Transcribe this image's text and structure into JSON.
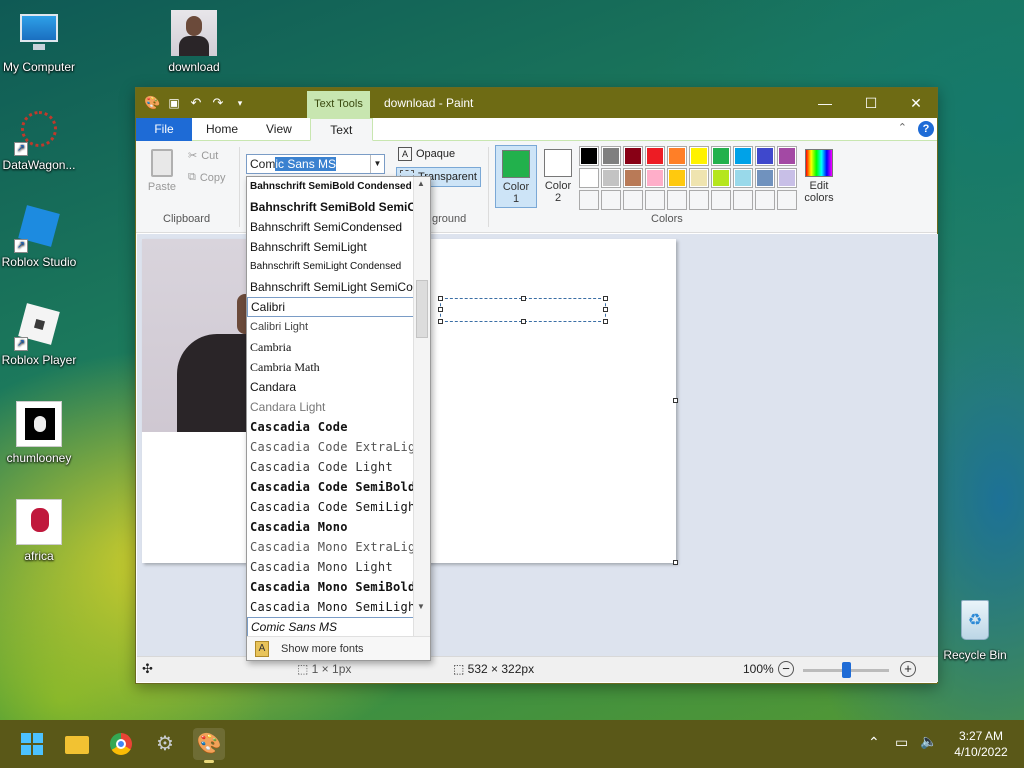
{
  "desktop": {
    "icons": [
      {
        "label": "My Computer"
      },
      {
        "label": "download"
      },
      {
        "label": "DataWagon..."
      },
      {
        "label": "Roblox Studio"
      },
      {
        "label": "Roblox Player"
      },
      {
        "label": "chumlooney"
      },
      {
        "label": "africa"
      },
      {
        "label": "Recycle Bin"
      }
    ]
  },
  "window": {
    "title": "download - Paint",
    "context_tab": "Text Tools",
    "tabs": [
      "File",
      "Home",
      "View",
      "Text"
    ]
  },
  "ribbon": {
    "clipboard": {
      "paste": "Paste",
      "cut": "Cut",
      "copy": "Copy",
      "group": "Clipboard"
    },
    "font_value": "Comic Sans MS",
    "font_value_parts": [
      "Com",
      "ic Sans MS"
    ],
    "background": {
      "opaque": "Opaque",
      "transparent": "Transparent",
      "group": "ground"
    },
    "colors": {
      "color1": "Color 1",
      "color1_line1": "Color",
      "color1_line2": "1",
      "color2": "Color 2",
      "color2_line1": "Color",
      "color2_line2": "2",
      "edit": "Edit colors",
      "edit_line1": "Edit",
      "edit_line2": "colors",
      "group": "Colors",
      "color1_hex": "#22b14c",
      "color2_hex": "#ffffff",
      "palette_row1": [
        "#000000",
        "#7f7f7f",
        "#880015",
        "#ed1c24",
        "#ff7f27",
        "#fff200",
        "#22b14c",
        "#00a2e8",
        "#3f48cc",
        "#a349a4"
      ],
      "palette_row2": [
        "#ffffff",
        "#c3c3c3",
        "#b97a57",
        "#ffaec9",
        "#ffc90e",
        "#efe4b0",
        "#b5e61d",
        "#99d9ea",
        "#7092be",
        "#c8bfe7"
      ]
    }
  },
  "font_list": {
    "items": [
      "Bahnschrift SemiBold Condensed",
      "Bahnschrift SemiBold SemiCondensed",
      "Bahnschrift SemiCondensed",
      "Bahnschrift SemiLight",
      "Bahnschrift SemiLight Condensed",
      "Bahnschrift SemiLight SemiCondensed",
      "Calibri",
      "Calibri Light",
      "Cambria",
      "Cambria Math",
      "Candara",
      "Candara Light",
      "Cascadia Code",
      "Cascadia Code ExtraLight",
      "Cascadia Code Light",
      "Cascadia Code SemiBold",
      "Cascadia Code SemiLight",
      "Cascadia Mono",
      "Cascadia Mono ExtraLight",
      "Cascadia Mono Light",
      "Cascadia Mono SemiBold",
      "Cascadia Mono SemiLight",
      "Comic Sans MS"
    ],
    "show_more": "Show more fonts"
  },
  "statusbar": {
    "selection": "1 × 1px",
    "canvas_size": "532 × 322px",
    "zoom": "100%",
    "zoom_level": 0.5
  },
  "taskbar": {
    "time": "3:27 AM",
    "date": "4/10/2022"
  }
}
